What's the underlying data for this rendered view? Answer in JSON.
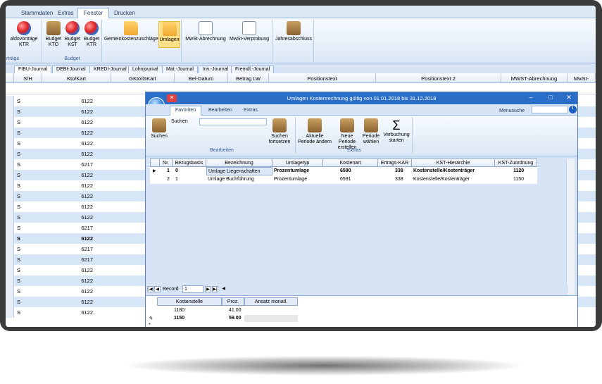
{
  "main_tabs": [
    "Stammdaten",
    "Extras",
    "Fenster",
    "Drucken"
  ],
  "ribbon": {
    "buttons": [
      {
        "label": "aldovorträge KTR",
        "icon": "globe-icon"
      },
      {
        "label": "Budget KTO",
        "icon": "calculator-icon"
      },
      {
        "label": "Budget KST",
        "icon": "globe-icon"
      },
      {
        "label": "Budget KTR",
        "icon": "globe-icon"
      },
      {
        "label": "Gemeinkostenzuschläge",
        "icon": "folder-icon"
      },
      {
        "label": "Umlagen",
        "icon": "folder-icon"
      },
      {
        "label": "MwSt-Abrechnung",
        "icon": "document-icon"
      },
      {
        "label": "MwSt-Verprobung",
        "icon": "printer-icon"
      },
      {
        "label": "Jahresabschluss",
        "icon": "calculator-icon"
      }
    ],
    "groups": [
      "rträge",
      "Budget"
    ]
  },
  "journal_tabs": [
    "FIBU-Journal",
    "DEBI-Journal",
    "KREDI-Journal",
    "Lohnjournal",
    "Mat.-Journal",
    "Inv.-Journal",
    "Fremdl.-Journal"
  ],
  "grid": {
    "headers": [
      "S/H",
      "Kto/Kart",
      "GKto/GKart",
      "Bel-Datum",
      "Betrag LW",
      "Positionstext",
      "Positionstext 2",
      "MWST-Abrechnung",
      "MwSt-"
    ],
    "rows": [
      {
        "sh": "S",
        "kto": "6122"
      },
      {
        "sh": "S",
        "kto": "6122"
      },
      {
        "sh": "S",
        "kto": "6122"
      },
      {
        "sh": "S",
        "kto": "6122"
      },
      {
        "sh": "S",
        "kto": "6122"
      },
      {
        "sh": "S",
        "kto": "6122"
      },
      {
        "sh": "S",
        "kto": "6217"
      },
      {
        "sh": "S",
        "kto": "6122"
      },
      {
        "sh": "S",
        "kto": "6122"
      },
      {
        "sh": "S",
        "kto": "6122"
      },
      {
        "sh": "S",
        "kto": "6122"
      },
      {
        "sh": "S",
        "kto": "6122"
      },
      {
        "sh": "S",
        "kto": "6217"
      },
      {
        "sh": "S",
        "kto": "6122",
        "bold": true
      },
      {
        "sh": "S",
        "kto": "6217"
      },
      {
        "sh": "S",
        "kto": "6217"
      },
      {
        "sh": "S",
        "kto": "6122"
      },
      {
        "sh": "S",
        "kto": "6122"
      },
      {
        "sh": "S",
        "kto": "6122"
      },
      {
        "sh": "S",
        "kto": "6122"
      },
      {
        "sh": "S",
        "kto": "6122"
      }
    ]
  },
  "dialog": {
    "title": "Umlagen Kostenrechnung gültig von 01.01.2018 bis 31.12.2018",
    "tabs": [
      "Favoriten",
      "Bearbeiten",
      "Extras"
    ],
    "menusuche": "Menusuche",
    "ribbon": {
      "suchen": "Suchen",
      "suchen_field": "Suchen",
      "suchen_fortsetzen": "Suchen fortsetzen",
      "aktuelle_periode": "Aktuelle Periode ändern",
      "neue_periode": "Neue Periode erstellen",
      "periode_waehlen": "Periode wählen",
      "verbuchung": "Verbuchung starten",
      "group_bearbeiten": "Bearbeiten",
      "group_extras": "Extras"
    },
    "table": {
      "headers": [
        "Nr.",
        "Bezugsbasis",
        "Bezeichnung",
        "Umlagetyp",
        "Kostenart",
        "Ertrags-KAR",
        "KST-Hierarchie",
        "KST-Zuordnung"
      ],
      "rows": [
        {
          "nr": "1",
          "basis": "0",
          "bez": "Umlage Liegenschaften",
          "typ": "Prozentumlage",
          "art": "6590",
          "kar": "338",
          "hier": "Kostenstelle/Kostenträger",
          "zuo": "1120",
          "bold": true
        },
        {
          "nr": "2",
          "basis": "1",
          "bez": "Umlage Buchführung",
          "typ": "Prozentumlage",
          "art": "6591",
          "kar": "338",
          "hier": "Kostenstelle/Kostenträger",
          "zuo": "1150"
        }
      ]
    },
    "nav": {
      "record_label": "Record",
      "record_value": "1"
    },
    "sub": {
      "headers": [
        "Kostenstelle",
        "Proz.",
        "Ansatz monatl."
      ],
      "rows": [
        {
          "kst": "1180",
          "proz": "41.00"
        },
        {
          "kst": "1150",
          "proz": "59.00",
          "bold": true
        }
      ]
    }
  }
}
